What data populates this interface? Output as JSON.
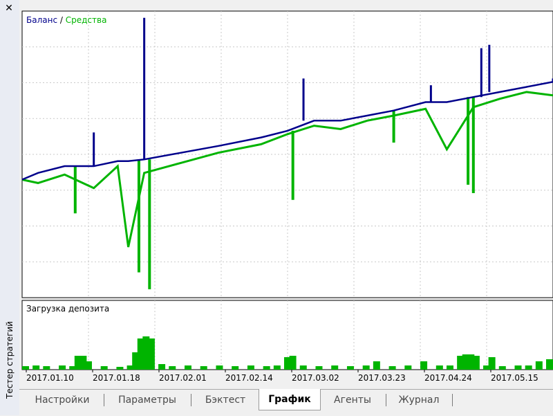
{
  "window": {
    "side_title": "Тестер стратегий",
    "close_icon": "close-icon"
  },
  "tabs": [
    {
      "label": "Настройки",
      "active": false
    },
    {
      "label": "Параметры",
      "active": false
    },
    {
      "label": "Бэктест",
      "active": false
    },
    {
      "label": "График",
      "active": true
    },
    {
      "label": "Агенты",
      "active": false
    },
    {
      "label": "Журнал",
      "active": false
    }
  ],
  "chart_data": [
    {
      "type": "line",
      "legend_position": "top-left",
      "grid": true,
      "series": [
        {
          "name": "Баланс",
          "color": "#00008b"
        },
        {
          "name": "Средства",
          "color": "#00b400"
        }
      ],
      "legend_separator": "/",
      "x_tick_labels": [
        "2017.01.10",
        "2017.01.18",
        "2017.02.01",
        "2017.02.14",
        "2017.03.02",
        "2017.03.23",
        "2017.04.24",
        "2017.05.15"
      ],
      "x": [
        0,
        0.03,
        0.08,
        0.135,
        0.18,
        0.2,
        0.23,
        0.3,
        0.37,
        0.45,
        0.5,
        0.55,
        0.6,
        0.65,
        0.7,
        0.76,
        0.8,
        0.85,
        0.9,
        0.95,
        1.0
      ],
      "balance": [
        100,
        104,
        108,
        108,
        111,
        111,
        112,
        116,
        120,
        125,
        129,
        135,
        135,
        138,
        141,
        146,
        146,
        149,
        152,
        155,
        158
      ],
      "equity": [
        100,
        98,
        103,
        95,
        108,
        60,
        104,
        110,
        116,
        121,
        127,
        132,
        130,
        135,
        138,
        142,
        118,
        143,
        148,
        152,
        150
      ],
      "balance_spikes": [
        {
          "x": 0.135,
          "value": 128
        },
        {
          "x": 0.23,
          "value": 196
        },
        {
          "x": 0.53,
          "value": 160
        },
        {
          "x": 0.77,
          "value": 156
        },
        {
          "x": 0.865,
          "value": 178
        },
        {
          "x": 0.88,
          "value": 180
        },
        {
          "x": 1.0,
          "value": 160
        }
      ],
      "equity_drops": [
        {
          "x": 0.1,
          "value": 80
        },
        {
          "x": 0.22,
          "value": 45
        },
        {
          "x": 0.24,
          "value": 35
        },
        {
          "x": 0.51,
          "value": 88
        },
        {
          "x": 0.7,
          "value": 122
        },
        {
          "x": 0.84,
          "value": 97
        },
        {
          "x": 0.85,
          "value": 92
        }
      ],
      "y_range": [
        30,
        200
      ]
    },
    {
      "type": "bar",
      "title": "Загрузка депозита",
      "color": "#00b400",
      "grid": true,
      "bars": [
        {
          "x": 0.0,
          "value": 0.05
        },
        {
          "x": 0.02,
          "value": 0.06
        },
        {
          "x": 0.04,
          "value": 0.05
        },
        {
          "x": 0.07,
          "value": 0.06
        },
        {
          "x": 0.09,
          "value": 0.05
        },
        {
          "x": 0.1,
          "value": 0.2
        },
        {
          "x": 0.11,
          "value": 0.2
        },
        {
          "x": 0.12,
          "value": 0.12
        },
        {
          "x": 0.15,
          "value": 0.05
        },
        {
          "x": 0.18,
          "value": 0.04
        },
        {
          "x": 0.2,
          "value": 0.06
        },
        {
          "x": 0.21,
          "value": 0.25
        },
        {
          "x": 0.22,
          "value": 0.45
        },
        {
          "x": 0.23,
          "value": 0.48
        },
        {
          "x": 0.24,
          "value": 0.45
        },
        {
          "x": 0.26,
          "value": 0.08
        },
        {
          "x": 0.28,
          "value": 0.05
        },
        {
          "x": 0.31,
          "value": 0.06
        },
        {
          "x": 0.34,
          "value": 0.05
        },
        {
          "x": 0.37,
          "value": 0.06
        },
        {
          "x": 0.4,
          "value": 0.05
        },
        {
          "x": 0.43,
          "value": 0.06
        },
        {
          "x": 0.46,
          "value": 0.05
        },
        {
          "x": 0.48,
          "value": 0.06
        },
        {
          "x": 0.5,
          "value": 0.18
        },
        {
          "x": 0.51,
          "value": 0.2
        },
        {
          "x": 0.53,
          "value": 0.06
        },
        {
          "x": 0.56,
          "value": 0.05
        },
        {
          "x": 0.59,
          "value": 0.06
        },
        {
          "x": 0.62,
          "value": 0.05
        },
        {
          "x": 0.65,
          "value": 0.06
        },
        {
          "x": 0.67,
          "value": 0.12
        },
        {
          "x": 0.7,
          "value": 0.05
        },
        {
          "x": 0.73,
          "value": 0.06
        },
        {
          "x": 0.76,
          "value": 0.12
        },
        {
          "x": 0.79,
          "value": 0.06
        },
        {
          "x": 0.81,
          "value": 0.06
        },
        {
          "x": 0.83,
          "value": 0.2
        },
        {
          "x": 0.84,
          "value": 0.22
        },
        {
          "x": 0.85,
          "value": 0.22
        },
        {
          "x": 0.86,
          "value": 0.2
        },
        {
          "x": 0.88,
          "value": 0.06
        },
        {
          "x": 0.89,
          "value": 0.18
        },
        {
          "x": 0.91,
          "value": 0.05
        },
        {
          "x": 0.94,
          "value": 0.06
        },
        {
          "x": 0.96,
          "value": 0.06
        },
        {
          "x": 0.98,
          "value": 0.12
        },
        {
          "x": 1.0,
          "value": 0.15
        }
      ],
      "y_range": [
        0,
        1
      ]
    }
  ]
}
